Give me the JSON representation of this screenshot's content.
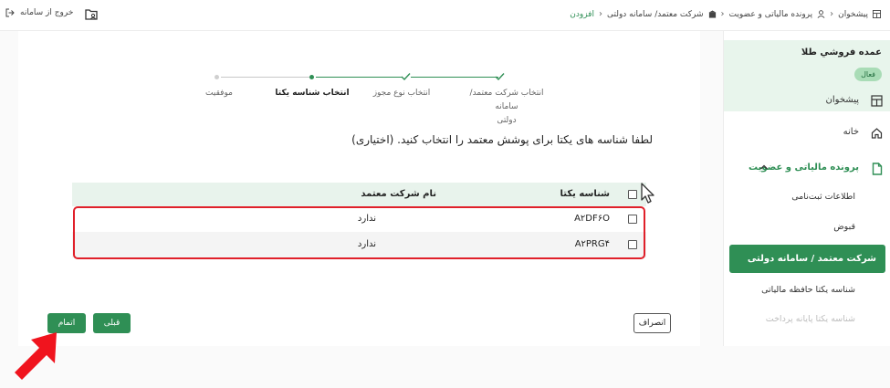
{
  "breadcrumb": {
    "items": [
      "پیشخوان",
      "پرونده مالیاتی و عضویت",
      "شرکت معتمد/ سامانه دولتی",
      "افزودن"
    ]
  },
  "header": {
    "logout_label": "خروج از سامانه"
  },
  "stepper": {
    "steps": [
      {
        "label": "انتخاب شرکت معتمد/سامانه",
        "label2": "دولتی",
        "state": "done"
      },
      {
        "label": "انتخاب نوع مجوز",
        "state": "done"
      },
      {
        "label": "انتخاب شناسه یکتا",
        "state": "active"
      },
      {
        "label": "موفقیت",
        "state": "pending"
      }
    ]
  },
  "prompt": "لطفا شناسه های یکتا برای پوشش معتمد را انتخاب کنید. (اختیاری)",
  "table": {
    "columns": [
      "شناسه یکتا",
      "نام شرکت معتمد"
    ],
    "rows": [
      {
        "id": "A۲DF۶O",
        "company": "ندارد"
      },
      {
        "id": "A۲PRG۴",
        "company": "ندارد"
      }
    ]
  },
  "buttons": {
    "cancel": "انصراف",
    "prev": "قبلی",
    "finish": "اتمام"
  },
  "sidebar": {
    "company_name": "عمده فروشي طلا",
    "status_badge": "فعال",
    "items": [
      {
        "label": "پیشخوان",
        "icon": "dashboard-icon"
      },
      {
        "label": "خانه",
        "icon": "home-icon"
      },
      {
        "label": "پرونده مالیاتی و عضویت",
        "icon": "document-icon"
      }
    ],
    "subitems": [
      {
        "label": "اطلاعات ثبت‌نامی"
      },
      {
        "label": "قبوض"
      },
      {
        "label": "شرکت معتمد / سامانه دولتی"
      },
      {
        "label": "شناسه یکتا حافظه مالیاتی"
      },
      {
        "label": "شناسه یکتا پایانه پرداخت"
      }
    ]
  },
  "colors": {
    "primary": "#2f8f55",
    "highlight": "#e0202a",
    "table_header": "#e8f3ec"
  }
}
